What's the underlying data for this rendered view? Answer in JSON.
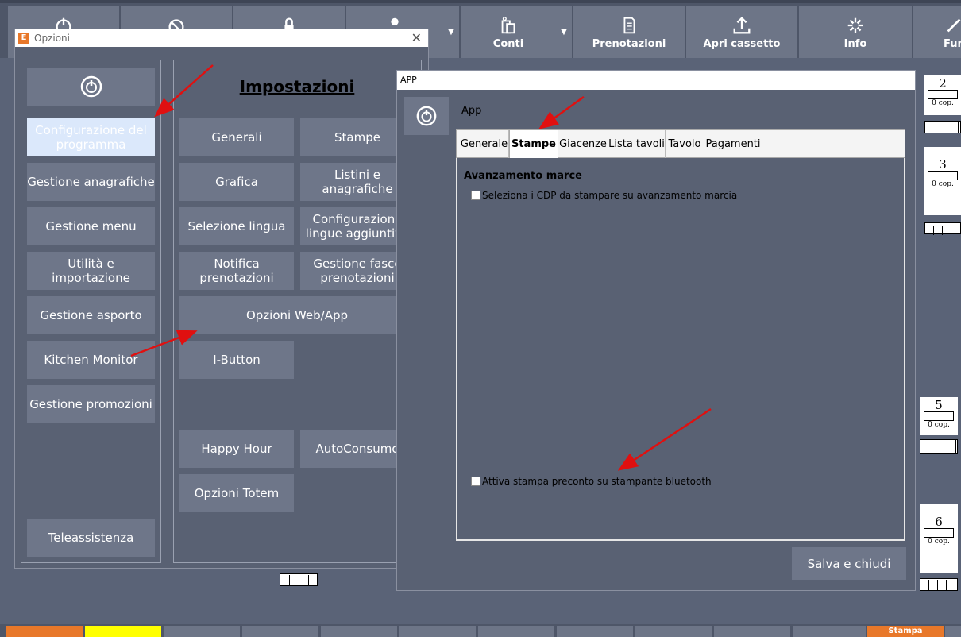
{
  "toolbar": {
    "conti": "Conti",
    "prenotazioni": "Prenotazioni",
    "apri_cassetto": "Apri cassetto",
    "info": "Info",
    "funzioni": "Fun"
  },
  "opzioni": {
    "title": "Opzioni",
    "logo_letter": "E",
    "left_menu": [
      "Configurazione del programma",
      "Gestione anagrafiche",
      "Gestione menu",
      "Utilità e importazione",
      "Gestione asporto",
      "Kitchen Monitor",
      "Gestione promozioni",
      "Teleassistenza"
    ],
    "heading": "Impostazioni",
    "settings": [
      "Generali",
      "Stampe",
      "Grafica",
      "Listini e anagrafiche",
      "Selezione lingua",
      "Configurazione lingue aggiuntive",
      "Notifica prenotazioni",
      "Gestione fasce prenotazioni",
      "Opzioni Web/App",
      "I-Button",
      "Happy Hour",
      "AutoConsumo",
      "Opzioni Totem"
    ]
  },
  "app": {
    "title": "APP",
    "header": "App",
    "tabs": [
      "Generale",
      "Stampe",
      "Giacenze",
      "Lista tavoli",
      "Tavolo",
      "Pagamenti"
    ],
    "active_tab": "Stampe",
    "section": "Avanzamento marce",
    "check1": "Seleziona i CDP da stampare su avanzamento marcia",
    "check2": "Attiva stampa preconto su stampante bluetooth",
    "save": "Salva e chiudi"
  },
  "tables": [
    {
      "number": "2",
      "covers": "0 cop."
    },
    {
      "number": "3",
      "covers": "0 cop."
    },
    {
      "number": "5",
      "covers": "0 cop."
    },
    {
      "number": "6",
      "covers": "0 cop."
    }
  ],
  "bottom": {
    "stampa": "Stampa"
  },
  "colors": {
    "arrow": "#e01010",
    "bg": "#5a6377",
    "button": "#6e7689",
    "accent": "#e8782a"
  }
}
